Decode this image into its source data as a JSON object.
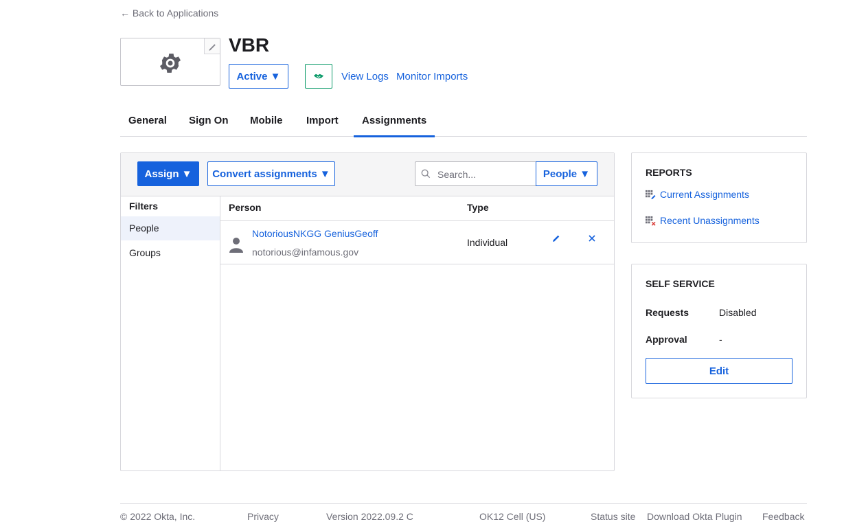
{
  "nav": {
    "back_label": "← Back to Applications"
  },
  "app": {
    "title": "VBR",
    "status_label": "Active ▼",
    "links": {
      "view_logs": "View Logs",
      "monitor_imports": "Monitor Imports"
    }
  },
  "tabs": [
    {
      "label": "General"
    },
    {
      "label": "Sign On"
    },
    {
      "label": "Mobile"
    },
    {
      "label": "Import"
    },
    {
      "label": "Assignments",
      "active": true
    }
  ],
  "toolbar": {
    "assign_label": "Assign ▼",
    "convert_label": "Convert assignments ▼",
    "search_placeholder": "Search...",
    "people_filter_label": "People ▼"
  },
  "filters": {
    "title": "Filters",
    "items": [
      {
        "label": "People",
        "active": true
      },
      {
        "label": "Groups"
      }
    ]
  },
  "table": {
    "headers": {
      "person": "Person",
      "type": "Type"
    },
    "rows": [
      {
        "name": "NotoriousNKGG GeniusGeoff",
        "email": "notorious@infamous.gov",
        "type": "Individual"
      }
    ]
  },
  "reports": {
    "title": "REPORTS",
    "links": [
      {
        "label": "Current Assignments",
        "icon": "grid-edit-icon"
      },
      {
        "label": "Recent Unassignments",
        "icon": "grid-remove-icon"
      }
    ]
  },
  "self_service": {
    "title": "SELF SERVICE",
    "requests_label": "Requests",
    "requests_value": "Disabled",
    "approval_label": "Approval",
    "approval_value": "-",
    "edit_label": "Edit"
  },
  "footer": {
    "copyright": "© 2022 Okta, Inc.",
    "privacy": "Privacy",
    "version": "Version 2022.09.2 C",
    "cell": "OK12 Cell (US)",
    "status_site": "Status site",
    "download_plugin": "Download Okta Plugin",
    "feedback": "Feedback"
  },
  "colors": {
    "accent": "#1662dd",
    "success": "#0d9b6a",
    "border": "#d7d7dc"
  }
}
